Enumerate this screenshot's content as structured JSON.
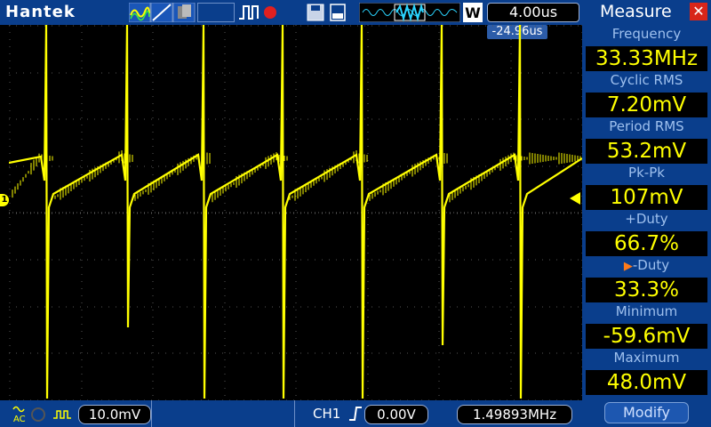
{
  "header": {
    "brand": "Hantek",
    "timebase": "4.00us",
    "trigger_position": "-24.96us"
  },
  "measure": {
    "title": "Measure",
    "close_icon": "close-icon",
    "items": [
      {
        "label": "Frequency",
        "value": "33.33MHz"
      },
      {
        "label": "Cyclic RMS",
        "value": "7.20mV"
      },
      {
        "label": "Period RMS",
        "value": "53.2mV"
      },
      {
        "label": "Pk-Pk",
        "value": "107mV"
      },
      {
        "label": "+Duty",
        "value": "66.7%"
      },
      {
        "label": "-Duty",
        "value": "33.3%",
        "selected": true
      },
      {
        "label": "Minimum",
        "value": "-59.6mV"
      },
      {
        "label": "Maximum",
        "value": "48.0mV"
      }
    ],
    "modify_label": "Modify"
  },
  "footer": {
    "volts_div": "10.0mV",
    "trigger_channel": "CH1",
    "trigger_level": "0.00V",
    "trigger_frequency": "1.49893MHz"
  },
  "channel": {
    "marker": "1",
    "color": "#ffff00"
  },
  "colors": {
    "panel": "#0a3e8c",
    "trace": "#ffff00",
    "close": "#d8261a",
    "record": "#e02020"
  }
}
